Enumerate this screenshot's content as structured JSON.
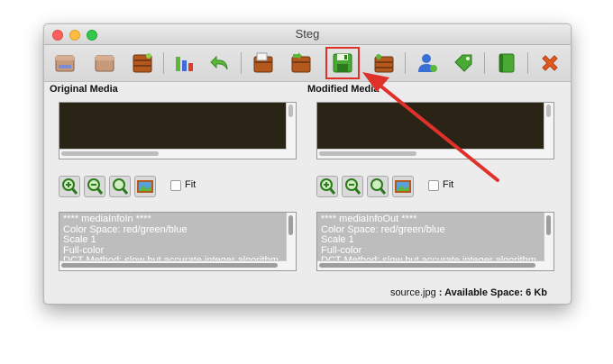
{
  "window": {
    "title": "Steg"
  },
  "toolbar": {
    "icons": [
      "database-icon",
      "box-icon",
      "chest-icon",
      "chart-icon",
      "undo-icon",
      "open-file-icon",
      "import-icon",
      "save-icon",
      "export-icon",
      "user-icon",
      "tag-icon",
      "book-icon",
      "close-icon"
    ]
  },
  "left": {
    "label": "Original Media",
    "fit_label": "Fit",
    "info_lines": [
      "**** mediaInfoIn ****",
      "Color Space: red/green/blue",
      "Scale 1",
      "Full-color",
      "DCT Method: slow but accurate integer algorithm"
    ]
  },
  "right": {
    "label": "Modified Media",
    "fit_label": "Fit",
    "info_lines": [
      "**** mediaInfoOut ****",
      "Color Space: red/green/blue",
      "Scale 1",
      "Full-color",
      "DCT Method: slow but accurate integer algorithm"
    ]
  },
  "status": {
    "file": "source.jpg",
    "separator": " : ",
    "space_label": "Available Space: 6 Kb"
  },
  "colors": {
    "accent": "#e0302a",
    "preview": "#2a2417"
  }
}
